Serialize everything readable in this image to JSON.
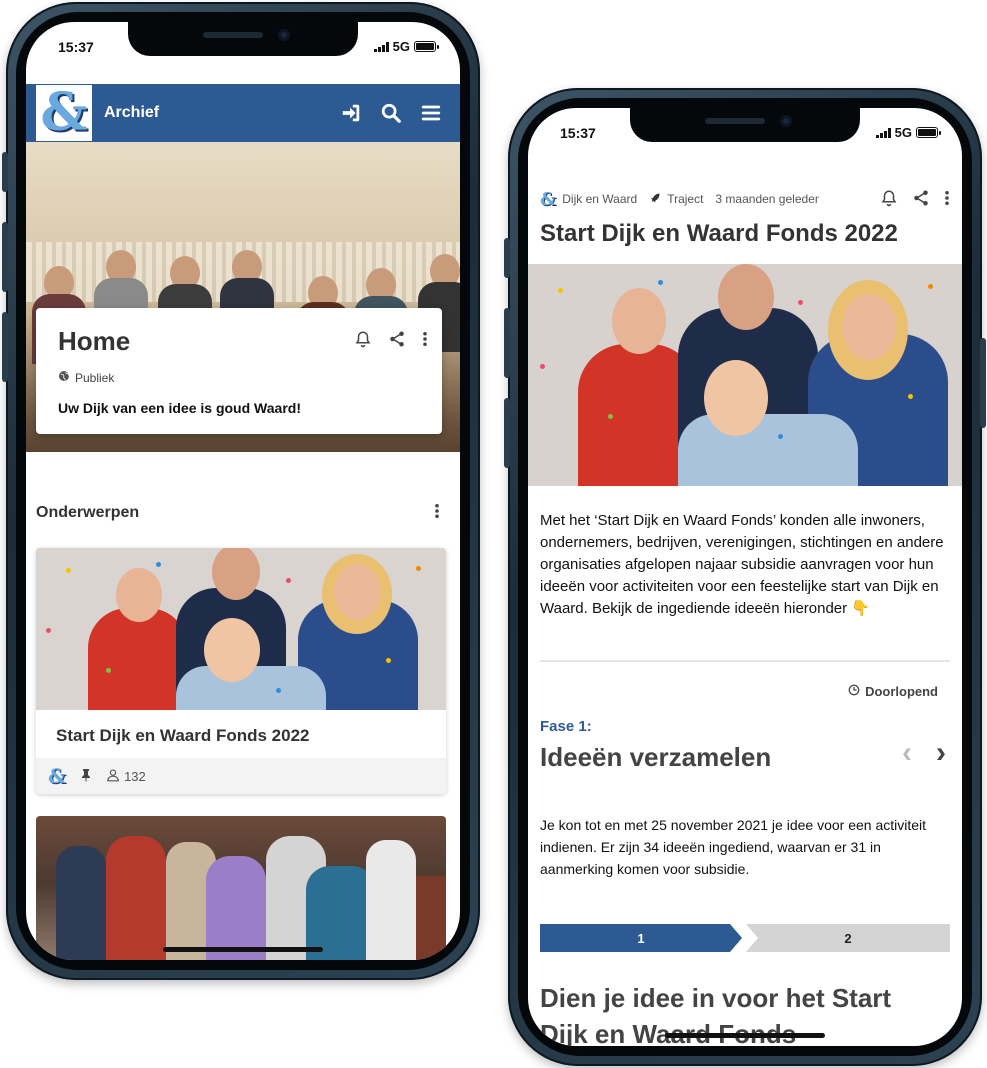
{
  "left_phone": {
    "status": {
      "time": "15:37",
      "network": "5G"
    },
    "appbar": {
      "logo": "&",
      "title": "Archief",
      "icons": [
        "login-icon",
        "search-icon",
        "menu-icon"
      ]
    },
    "home_card": {
      "title": "Home",
      "visibility": "Publiek",
      "tagline": "Uw Dijk van een idee is goud Waard!"
    },
    "section": {
      "title": "Onderwerpen"
    },
    "topic": {
      "title": "Start Dijk en Waard Fonds 2022",
      "logo": "&",
      "followers": "132"
    }
  },
  "right_phone": {
    "status": {
      "time": "15:37",
      "network": "5G"
    },
    "crumb": {
      "logo": "&",
      "org": "Dijk en Waard",
      "type": "Traject",
      "time": "3 maanden geleden"
    },
    "title": "Start Dijk en Waard Fonds 2022",
    "intro": "Met het ‘Start Dijk en Waard Fonds’ konden alle inwoners, ondernemers, bedrijven, verenigingen, stichtingen en andere organisaties afgelopen najaar subsidie aanvragen voor hun ideeën voor activiteiten voor een feestelijke start van Dijk en Waard. Bekijk de ingediende ideeën hieronder 👇",
    "status_label": "Doorlopend",
    "phase": {
      "label": "Fase 1:",
      "title": "Ideeën verzamelen",
      "text": "Je kon tot en met 25 november 2021 je idee voor een activiteit indienen. Er zijn 34 ideeën ingediend, waarvan er 31 in aanmerking komen voor subsidie."
    },
    "steps": [
      "1",
      "2"
    ],
    "cta": "Dien je idee in voor het Start Dijk en Waard Fonds"
  },
  "colors": {
    "brand_blue": "#2e5a93",
    "logo_blue": "#6aa9df"
  }
}
